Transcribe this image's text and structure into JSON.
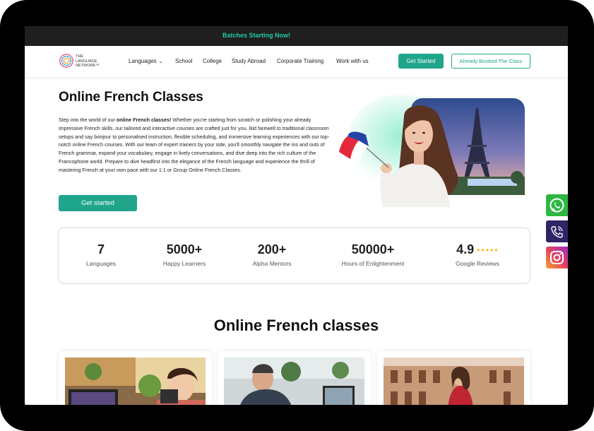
{
  "banner": {
    "text": "Batches Starting Now!"
  },
  "logo": {
    "line1": "THE",
    "line2": "LANGUAGE",
    "line3": "NETWORK™"
  },
  "nav": {
    "items": [
      "Languages",
      "School",
      "College",
      "Study Abroad",
      "Corporate Training",
      "Work with us"
    ],
    "get_started": "Get Started",
    "booked": "Already Booked The Class"
  },
  "hero": {
    "title": "Online French Classes",
    "para_prefix": "Step into the world of our ",
    "para_bold": "online French classes!",
    "para_rest": " Whether you're starting from scratch or polishing your already impressive French skills, our tailored and interactive courses are crafted just for you. Bid farewell to traditional classroom setups and say bonjour to personalised instruction, flexible scheduling, and immersive learning experiences with our top-notch online French courses. With our team of expert trainers by your side, you'll smoothly navigate the ins and outs of French grammar, expand your vocabulary, engage in lively conversations, and dive deep into the rich culture of the Francophone world. Prepare to dive headfirst into the elegance of the French language and experience the thrill of mastering French at your own pace with our 1:1 or Group Online French Classes.",
    "cta": "Get started"
  },
  "stats": [
    {
      "num": "7",
      "label": "Languages"
    },
    {
      "num": "5000+",
      "label": "Happy Learners"
    },
    {
      "num": "200+",
      "label": "Alpha Mentors"
    },
    {
      "num": "50000+",
      "label": "Hours of Enlightenment"
    },
    {
      "num": "4.9",
      "label": "Google Reviews",
      "stars": "★★★★★"
    }
  ],
  "section": {
    "title": "Online French classes"
  },
  "colors": {
    "accent": "#1fa58a",
    "banner_text": "#22c9a3",
    "topbar": "#1f1f1f"
  },
  "social": [
    "whatsapp-icon",
    "phone-icon",
    "instagram-icon"
  ]
}
